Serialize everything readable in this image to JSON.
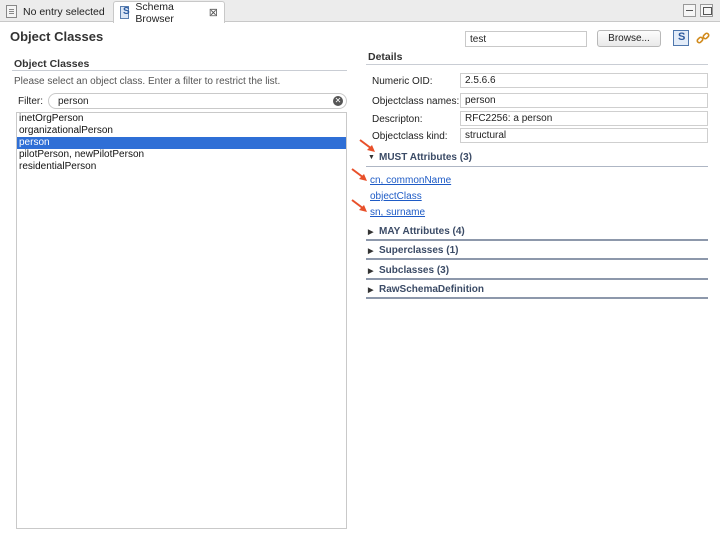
{
  "tabs": [
    {
      "label": "No entry selected",
      "icon": "document-icon"
    },
    {
      "label": "Schema Browser",
      "icon": "schema-icon",
      "close": "⊠"
    }
  ],
  "header": {
    "title": "Object Classes",
    "connection_value": "test",
    "browse_label": "Browse..."
  },
  "left": {
    "section_title": "Object Classes",
    "hint": "Please select an object class. Enter a filter to restrict the list.",
    "filter_label": "Filter:",
    "filter_value": "person",
    "items": [
      "inetOrgPerson",
      "organizationalPerson",
      "person",
      "pilotPerson, newPilotPerson",
      "residentialPerson"
    ],
    "selected_index": 2
  },
  "details": {
    "section_title": "Details",
    "fields": [
      {
        "label": "Numeric OID:",
        "value": "2.5.6.6"
      },
      {
        "label": "Objectclass names:",
        "value": "person"
      },
      {
        "label": "Descripton:",
        "value": "RFC2256: a person"
      },
      {
        "label": "Objectclass kind:",
        "value": "structural"
      }
    ],
    "must": {
      "label": "MUST Attributes (3)",
      "attributes": [
        "cn, commonName",
        "objectClass",
        "sn, surname"
      ]
    },
    "sections": [
      {
        "label": "MAY Attributes (4)"
      },
      {
        "label": "Superclasses (1)"
      },
      {
        "label": "Subclasses (3)"
      },
      {
        "label": "RawSchemaDefinition"
      }
    ]
  },
  "colors": {
    "selection": "#2f6fd6",
    "link": "#1e5bc6",
    "annotation_arrow": "#e8502a"
  }
}
